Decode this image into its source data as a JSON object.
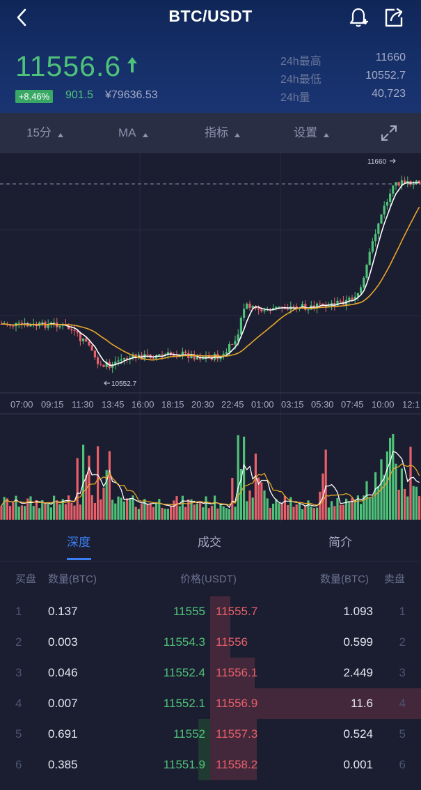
{
  "header": {
    "title": "BTC/USDT",
    "price": "11556.6",
    "change_pct": "+8.46%",
    "change_abs": "901.5",
    "cny_price": "¥79636.53",
    "stats": [
      {
        "label": "24h最高",
        "value": "11660"
      },
      {
        "label": "24h最低",
        "value": "10552.7"
      },
      {
        "label": "24h量",
        "value": "40,723"
      }
    ]
  },
  "toolbar": {
    "interval": "15分",
    "indicator_main": "MA",
    "indicators": "指标",
    "settings": "设置"
  },
  "chart": {
    "high_marker": "11660",
    "low_marker": "10552.7",
    "time_ticks": [
      "07:00",
      "09:15",
      "11:30",
      "13:45",
      "16:00",
      "18:15",
      "20:30",
      "22:45",
      "01:00",
      "03:15",
      "05:30",
      "07:45",
      "10:00",
      "12:1"
    ]
  },
  "tabs": [
    {
      "label": "深度"
    },
    {
      "label": "成交"
    },
    {
      "label": "简介"
    }
  ],
  "orderbook": {
    "headers": {
      "bid_side": "买盘",
      "bid_qty": "数量(BTC)",
      "price": "价格(USDT)",
      "ask_qty": "数量(BTC)",
      "ask_side": "卖盘"
    },
    "rows": [
      {
        "idx": "1",
        "bid_qty": "0.137",
        "bid_price": "11555",
        "ask_price": "11555.7",
        "ask_qty": "1.093",
        "ask_idx": "1"
      },
      {
        "idx": "2",
        "bid_qty": "0.003",
        "bid_price": "11554.3",
        "ask_price": "11556",
        "ask_qty": "0.599",
        "ask_idx": "2"
      },
      {
        "idx": "3",
        "bid_qty": "0.046",
        "bid_price": "11552.4",
        "ask_price": "11556.1",
        "ask_qty": "2.449",
        "ask_idx": "3"
      },
      {
        "idx": "4",
        "bid_qty": "0.007",
        "bid_price": "11552.1",
        "ask_price": "11556.9",
        "ask_qty": "11.6",
        "ask_idx": "4"
      },
      {
        "idx": "5",
        "bid_qty": "0.691",
        "bid_price": "11552",
        "ask_price": "11557.3",
        "ask_qty": "0.524",
        "ask_idx": "5"
      },
      {
        "idx": "6",
        "bid_qty": "0.385",
        "bid_price": "11551.9",
        "ask_price": "11558.2",
        "ask_qty": "0.001",
        "ask_idx": "6"
      }
    ]
  },
  "colors": {
    "up": "#4fc27a",
    "down": "#e8606a",
    "accent": "#3a7ef2"
  }
}
